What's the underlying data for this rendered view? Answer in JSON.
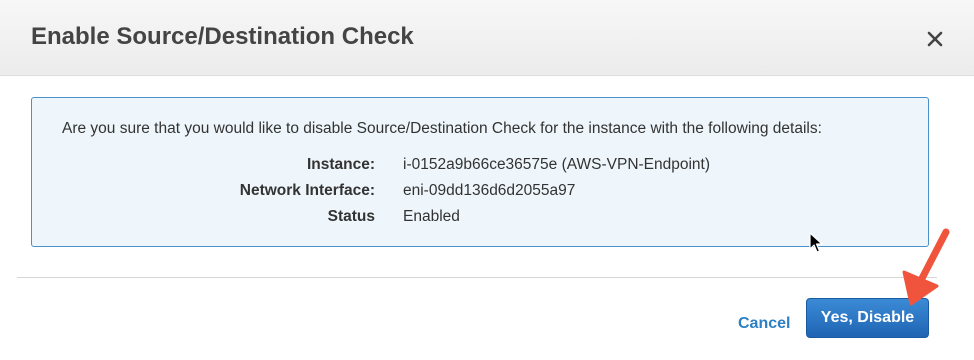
{
  "dialog": {
    "title": "Enable Source/Destination Check",
    "close_icon": "close-icon",
    "close_glyph": "✕"
  },
  "info": {
    "question": "Are you sure that you would like to disable Source/Destination Check for the instance with the following details:",
    "details": [
      {
        "label": "Instance:",
        "value": "i-0152a9b66ce36575e (AWS-VPN-Endpoint)"
      },
      {
        "label": "Network Interface:",
        "value": "eni-09dd136d6d2055a97"
      },
      {
        "label": "Status",
        "value": "Enabled"
      }
    ],
    "border_color": "#4a90c9",
    "background_color": "#eef6fb"
  },
  "footer": {
    "cancel_label": "Cancel",
    "confirm_label": "Yes, Disable"
  },
  "colors": {
    "primary": "#2873c8",
    "link": "#2c7fc4",
    "annotation_arrow": "#f0543c"
  },
  "icons": {
    "mouse_cursor": "arrow-pointer-icon",
    "annotation": "red-arrow-icon"
  }
}
